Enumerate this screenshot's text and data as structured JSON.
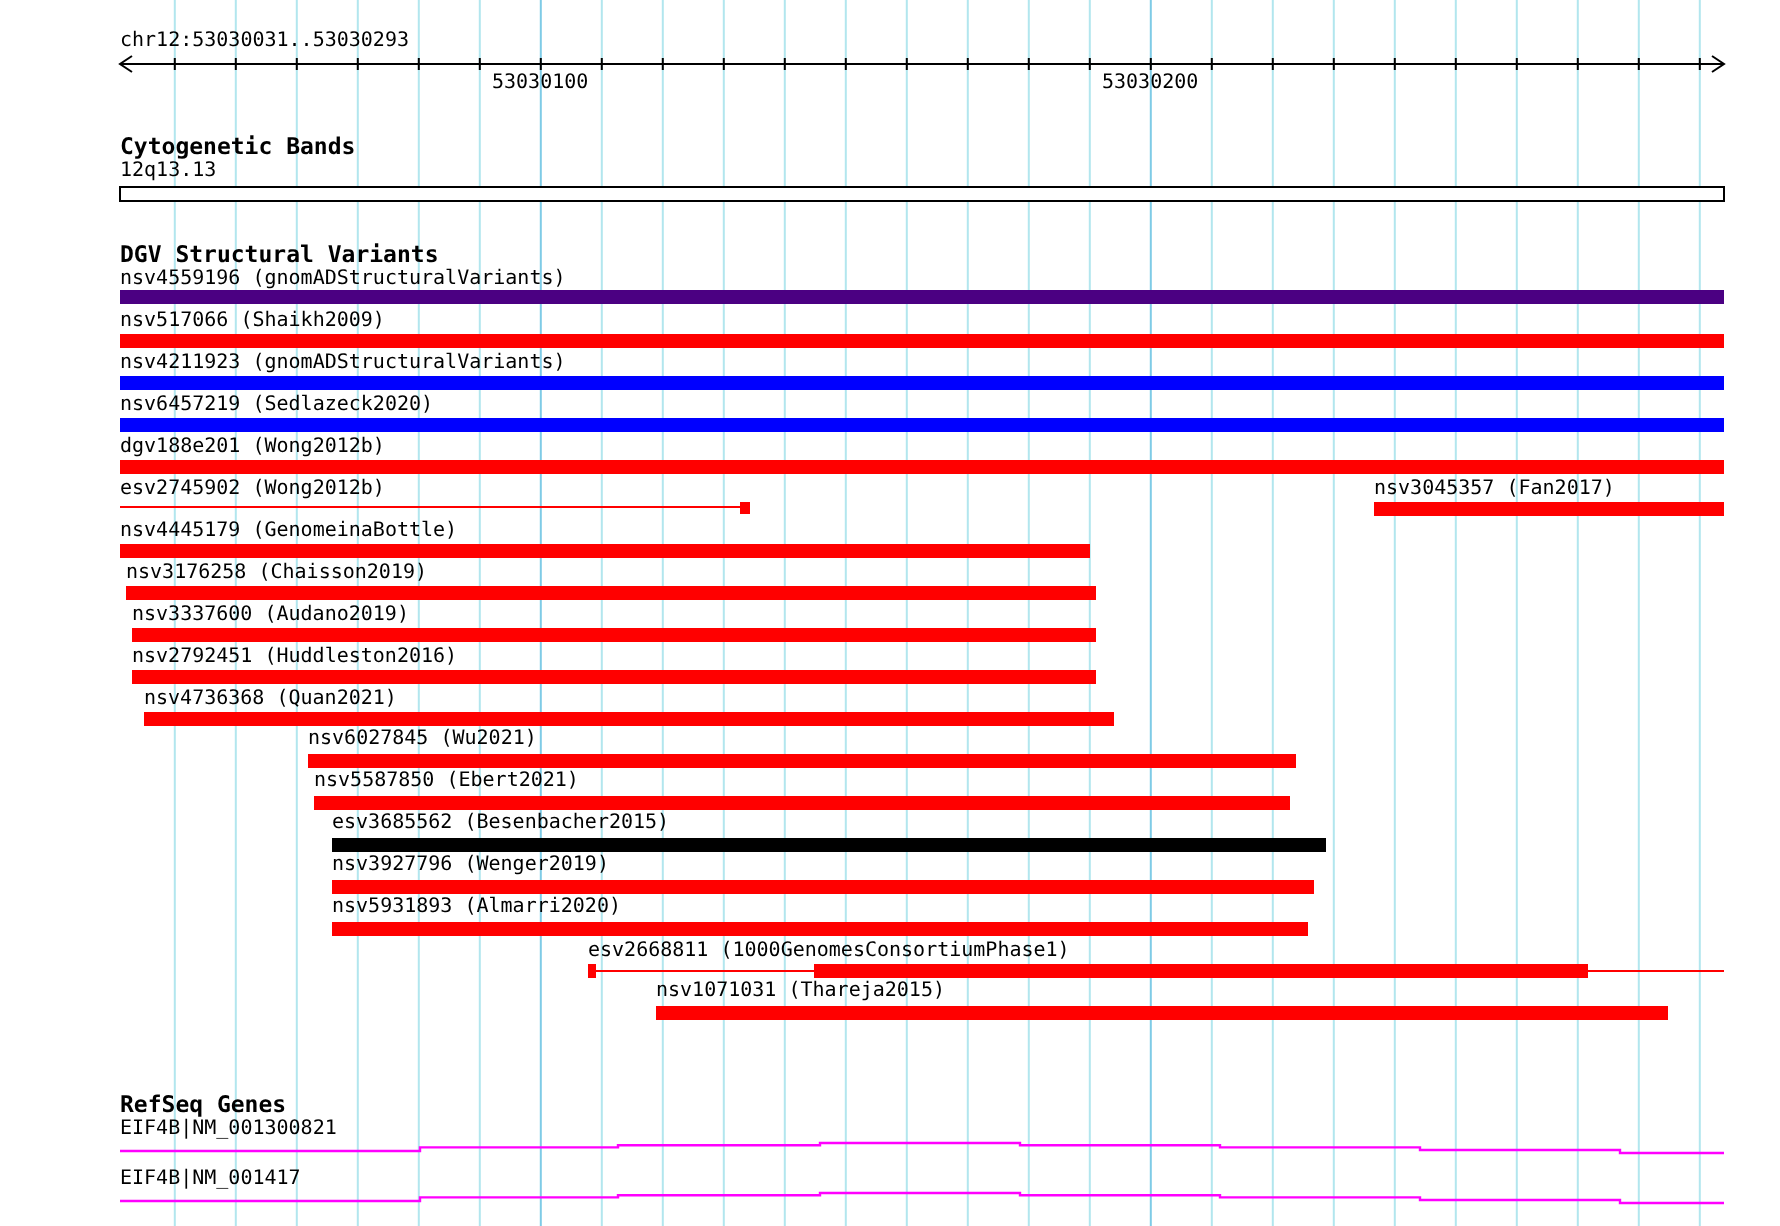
{
  "ruler": {
    "location": "chr12:53030031..53030293",
    "tick_labels": [
      "53030100",
      "53030200"
    ]
  },
  "tracks": [
    {
      "kind": "cytoband",
      "title": "Cytogenetic Bands",
      "features": [
        {
          "label": "12q13.13"
        }
      ]
    },
    {
      "kind": "variants",
      "title": "DGV Structural Variants",
      "features": [
        {
          "label": "nsv4559196 (gnomADStructuralVariants)",
          "color": "#4b0082"
        },
        {
          "label": "nsv517066 (Shaikh2009)",
          "color": "#ff0000"
        },
        {
          "label": "nsv4211923 (gnomADStructuralVariants)",
          "color": "#0000ff"
        },
        {
          "label": "nsv6457219 (Sedlazeck2020)",
          "color": "#0000ff"
        },
        {
          "label": "dgv188e201 (Wong2012b)",
          "color": "#ff0000"
        },
        {
          "label": "esv2745902 (Wong2012b)",
          "color": "#ff0000"
        },
        {
          "label": "nsv3045357 (Fan2017)",
          "color": "#ff0000"
        },
        {
          "label": "nsv4445179 (GenomeinaBottle)",
          "color": "#ff0000"
        },
        {
          "label": "nsv3176258 (Chaisson2019)",
          "color": "#ff0000"
        },
        {
          "label": "nsv3337600 (Audano2019)",
          "color": "#ff0000"
        },
        {
          "label": "nsv2792451 (Huddleston2016)",
          "color": "#ff0000"
        },
        {
          "label": "nsv4736368 (Quan2021)",
          "color": "#ff0000"
        },
        {
          "label": "nsv6027845 (Wu2021)",
          "color": "#ff0000"
        },
        {
          "label": "nsv5587850 (Ebert2021)",
          "color": "#ff0000"
        },
        {
          "label": "esv3685562 (Besenbacher2015)",
          "color": "#000000"
        },
        {
          "label": "nsv3927796 (Wenger2019)",
          "color": "#ff0000"
        },
        {
          "label": "nsv5931893 (Almarri2020)",
          "color": "#ff0000"
        },
        {
          "label": "esv2668811 (1000GenomesConsortiumPhase1)",
          "color": "#ff0000"
        },
        {
          "label": "nsv1071031 (Thareja2015)",
          "color": "#ff0000"
        }
      ]
    },
    {
      "kind": "genes",
      "title": "RefSeq Genes",
      "features": [
        {
          "label": "EIF4B|NM_001300821"
        },
        {
          "label": "EIF4B|NM_001417"
        }
      ]
    }
  ]
}
